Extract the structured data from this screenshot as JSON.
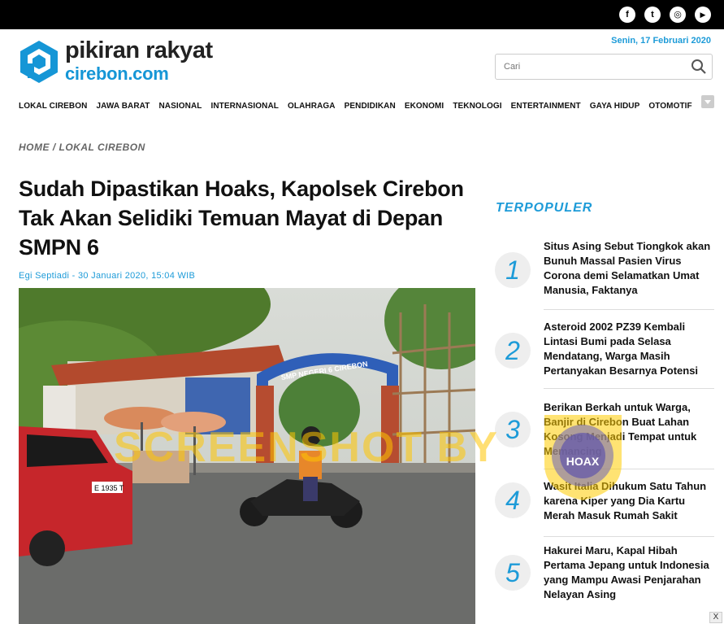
{
  "social": {
    "icons": [
      "facebook-icon",
      "twitter-icon",
      "instagram-icon",
      "youtube-icon"
    ],
    "glyphs": [
      "f",
      "t",
      "◎",
      "▶"
    ]
  },
  "header": {
    "logo_line1": "pikiran rakyat",
    "logo_line2": "cirebon.com",
    "date": "Senin, 17 Februari 2020",
    "search_placeholder": "Cari",
    "brand_color": "#1596d6"
  },
  "nav": {
    "items": [
      "LOKAL CIREBON",
      "JAWA BARAT",
      "NASIONAL",
      "INTERNASIONAL",
      "OLAHRAGA",
      "PENDIDIKAN",
      "EKONOMI",
      "TEKNOLOGI",
      "ENTERTAINMENT",
      "GAYA HIDUP",
      "OTOMOTIF"
    ]
  },
  "article": {
    "breadcrumb": "HOME / LOKAL CIREBON",
    "title": "Sudah Dipastikan Hoaks, Kapolsek Cirebon Tak Akan Selidiki Temuan Mayat di Depan SMPN 6",
    "byline": "Egi Septiadi - 30 Januari 2020, 15:04 WIB",
    "photo_school_sign": "SMP NEGERI 6 CIREBON",
    "photo_plate": "E 1935 T"
  },
  "watermark": {
    "text": "SCREENSHOT BY",
    "seal_text": "HOAX"
  },
  "sidebar": {
    "title": "TERPOPULER",
    "items": [
      {
        "num": "1",
        "text": "Situs Asing Sebut Tiongkok akan Bunuh Massal Pasien Virus Corona demi Selamatkan Umat Manusia, Faktanya"
      },
      {
        "num": "2",
        "text": "Asteroid 2002 PZ39 Kembali Lintasi Bumi pada Selasa Mendatang, Warga Masih Pertanyakan Besarnya Potensi"
      },
      {
        "num": "3",
        "text": "Berikan Berkah untuk Warga, Banjir di Cirebon Buat Lahan Kosong Menjadi Tempat untuk Memancing"
      },
      {
        "num": "4",
        "text": "Wasit Italia Dihukum Satu Tahun karena Kiper yang Dia Kartu Merah Masuk Rumah Sakit"
      },
      {
        "num": "5",
        "text": "Hakurei Maru, Kapal Hibah Pertama Jepang untuk Indonesia yang Mampu Awasi Penjarahan Nelayan Asing"
      }
    ]
  },
  "close_label": "X"
}
